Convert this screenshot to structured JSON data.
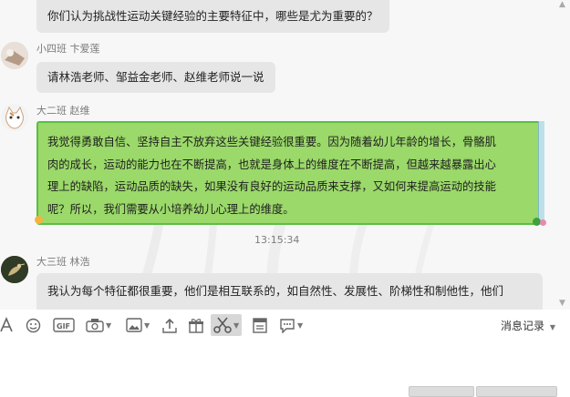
{
  "messages": [
    {
      "text": "你们认为挑战性运动关键经验的主要特征中，哪些是尤为重要的？"
    },
    {
      "sender": "小四班 卞爱莲",
      "text": "请林浩老师、邹益金老师、赵维老师说一说"
    },
    {
      "sender": "大二班 赵维",
      "lines": [
        "我觉得勇敢自信、坚持自主不放弃这些关键经验很重要。因为随着幼儿年龄的增长，骨骼肌",
        "肉的成长，运动的能力也在不断提高，也就是身体上的维度在不断提高，但越来越暴露出心",
        "理上的缺陷，运动品质的缺失，如果没有良好的运动品质来支撑，又如何来提高运动的技能",
        "呢？所以，我们需要从小培养幼儿心理上的维度。"
      ]
    },
    {
      "sender": "大三班 林浩",
      "text": "我认为每个特征都很重要，他们是相互联系的，如自然性、发展性、阶梯性和制他性，他们"
    }
  ],
  "timestamp": "13:15:34",
  "toolbar": {
    "items": [
      "font-icon",
      "emoji-icon",
      "gif-icon",
      "camera-icon",
      "image-icon",
      "upload-icon",
      "gift-icon",
      "scissors-icon",
      "doc-icon",
      "chat-bubble-icon"
    ],
    "history_label": "消息记录"
  },
  "colors": {
    "chat_bg": "#f7f7f7",
    "bubble": "#e6e6e6",
    "green_bubble": "#9bd96a",
    "green_border": "#5bbe44"
  }
}
